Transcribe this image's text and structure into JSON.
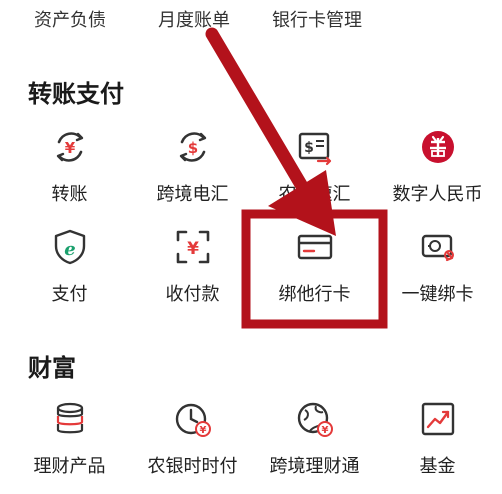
{
  "top_links": [
    "资产负债",
    "月度账单",
    "银行卡管理"
  ],
  "sections": {
    "transfer": {
      "title": "转账支付",
      "items": [
        {
          "label": "转账",
          "icon": "transfer-icon"
        },
        {
          "label": "跨境电汇",
          "icon": "cross-border-remit-icon"
        },
        {
          "label": "农银速汇",
          "icon": "fast-remit-icon"
        },
        {
          "label": "数字人民币",
          "icon": "digital-rmb-icon"
        },
        {
          "label": "支付",
          "icon": "payment-shield-icon"
        },
        {
          "label": "收付款",
          "icon": "scan-yuan-icon"
        },
        {
          "label": "绑他行卡",
          "icon": "bank-card-icon"
        },
        {
          "label": "一键绑卡",
          "icon": "one-click-bind-icon"
        }
      ]
    },
    "wealth": {
      "title": "财富",
      "items": [
        {
          "label": "理财产品",
          "icon": "coin-stack-icon"
        },
        {
          "label": "农银时时付",
          "icon": "clock-yuan-icon"
        },
        {
          "label": "跨境理财通",
          "icon": "globe-icon"
        },
        {
          "label": "基金",
          "icon": "fund-chart-icon"
        }
      ]
    }
  },
  "colors": {
    "icon_dark": "#333333",
    "icon_red": "#e43a3a",
    "annotation_red": "#b3121b"
  }
}
